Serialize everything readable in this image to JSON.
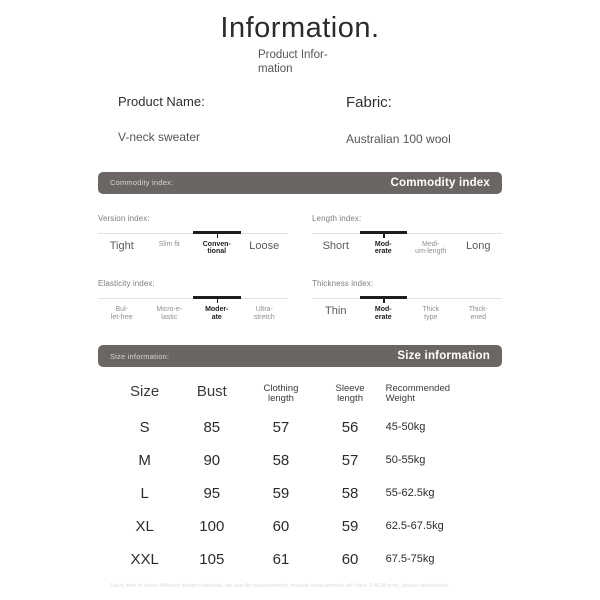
{
  "header": {
    "title": "Information.",
    "subtitle_line1": "Product Infor-",
    "subtitle_line2": "mation"
  },
  "product": {
    "name_label": "Product Name:",
    "name_value": "V-neck sweater",
    "fabric_label": "Fabric:",
    "fabric_value": "Australian 100 wool"
  },
  "commodity_banner": {
    "left": "Commodity index:",
    "right": "Commodity index"
  },
  "size_banner": {
    "left": "Size information:",
    "right": "Size information"
  },
  "indexes": [
    {
      "title": "Version index:",
      "selected": 2,
      "options": [
        {
          "line1": "Tight",
          "line2": ""
        },
        {
          "line1": "Slim fit",
          "line2": ""
        },
        {
          "line1": "Conven-",
          "line2": "tional"
        },
        {
          "line1": "Loose",
          "line2": ""
        }
      ]
    },
    {
      "title": "Length index:",
      "selected": 1,
      "options": [
        {
          "line1": "Short",
          "line2": ""
        },
        {
          "line1": "Mod-",
          "line2": "erate"
        },
        {
          "line1": "Medi-",
          "line2": "um-length"
        },
        {
          "line1": "Long",
          "line2": ""
        }
      ]
    },
    {
      "title": "Elasticity index:",
      "selected": 2,
      "options": [
        {
          "line1": "Bul-",
          "line2": "let-free"
        },
        {
          "line1": "Micro-e-",
          "line2": "lastic"
        },
        {
          "line1": "Moder-",
          "line2": "ate"
        },
        {
          "line1": "Ultra-",
          "line2": "stretch"
        }
      ]
    },
    {
      "title": "Thickness index:",
      "selected": 1,
      "options": [
        {
          "line1": "Thin",
          "line2": ""
        },
        {
          "line1": "Mod-",
          "line2": "erate"
        },
        {
          "line1": "Thick",
          "line2": "type"
        },
        {
          "line1": "Thick-",
          "line2": "ened"
        }
      ]
    }
  ],
  "size_table": {
    "headers": [
      {
        "line1": "Size",
        "line2": ""
      },
      {
        "line1": "Bust",
        "line2": ""
      },
      {
        "line1": "Clothing",
        "line2": "length"
      },
      {
        "line1": "Sleeve",
        "line2": "length"
      },
      {
        "line1": "Recommended",
        "line2": "Weight"
      }
    ],
    "rows": [
      {
        "size": "S",
        "bust": "85",
        "clothing_length": "57",
        "sleeve_length": "56",
        "weight": "45-50kg"
      },
      {
        "size": "M",
        "bust": "90",
        "clothing_length": "58",
        "sleeve_length": "57",
        "weight": "50-55kg"
      },
      {
        "size": "L",
        "bust": "95",
        "clothing_length": "59",
        "sleeve_length": "58",
        "weight": "55-62.5kg"
      },
      {
        "size": "XL",
        "bust": "100",
        "clothing_length": "60",
        "sleeve_length": "59",
        "weight": "62.5-67.5kg"
      },
      {
        "size": "XXL",
        "bust": "105",
        "clothing_length": "61",
        "sleeve_length": "60",
        "weight": "67.5-75kg"
      }
    ]
  },
  "footnote": "Every item of dress different design materials, we use tile measurement, manual measurement will have 2-4CM error, please understand.",
  "colors": {
    "banner_bg": "#6b6664",
    "selection_bar": "#1d1d1d",
    "track": "#e2e2e2",
    "page_bg": "#ffffff"
  }
}
